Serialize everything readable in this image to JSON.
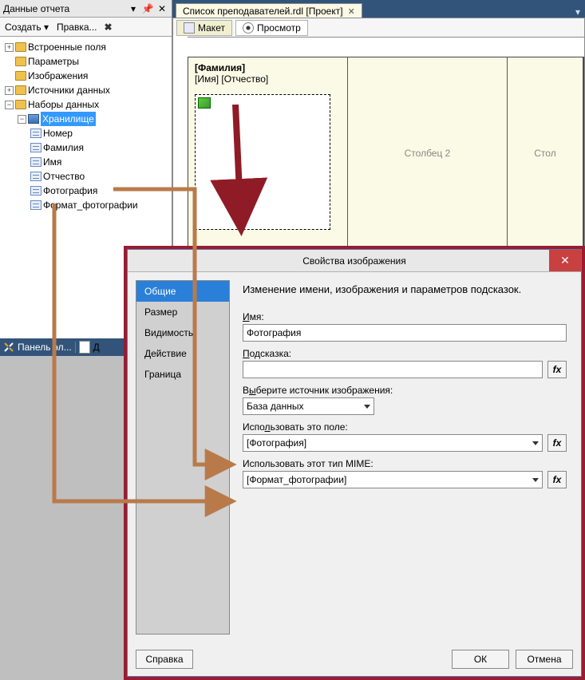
{
  "panel": {
    "title": "Данные отчета",
    "menu_create": "Создать ▾",
    "menu_edit": "Правка...",
    "tree": {
      "builtin": "Встроенные поля",
      "params": "Параметры",
      "images": "Изображения",
      "sources": "Источники данных",
      "datasets": "Наборы данных",
      "ds_name": "Хранилище",
      "f_id": "Номер",
      "f_last": "Фамилия",
      "f_first": "Имя",
      "f_mid": "Отчество",
      "f_photo": "Фотография",
      "f_fmt": "Формат_фотографии"
    }
  },
  "bottom_tabs": {
    "label1": "Панель эл...",
    "label2": "Д"
  },
  "doc": {
    "tab": "Список преподавателей.rdl [Проект]",
    "view_design": "Макет",
    "view_preview": "Просмотр",
    "cell_last": "[Фамилия]",
    "cell_first": "[Имя]",
    "cell_mid": "[Отчество]",
    "col2": "Столбец 2",
    "col3": "Стол"
  },
  "dialog": {
    "title": "Свойства изображения",
    "close": "✕",
    "side": {
      "general": "Общие",
      "size": "Размер",
      "visibility": "Видимость",
      "action": "Действие",
      "border": "Граница"
    },
    "heading": "Изменение имени, изображения и параметров подсказок.",
    "lbl_name_u": "И",
    "lbl_name_rest": "мя:",
    "val_name": "Фотография",
    "lbl_tip_u": "П",
    "lbl_tip_rest": "одсказка:",
    "val_tip": "",
    "lbl_src_pre": "В",
    "lbl_src_u": "ы",
    "lbl_src_rest": "берите источник изображения:",
    "val_src": "База данных",
    "lbl_field_pre": "Испо",
    "lbl_field_u": "л",
    "lbl_field_rest": "ьзовать это поле:",
    "val_field": "[Фотография]",
    "lbl_mime": "Использовать этот тип MIME:",
    "val_mime": "[Формат_фотографии]",
    "btn_help": "Справка",
    "btn_ok": "ОК",
    "btn_cancel": "Отмена",
    "fx": "fx"
  }
}
